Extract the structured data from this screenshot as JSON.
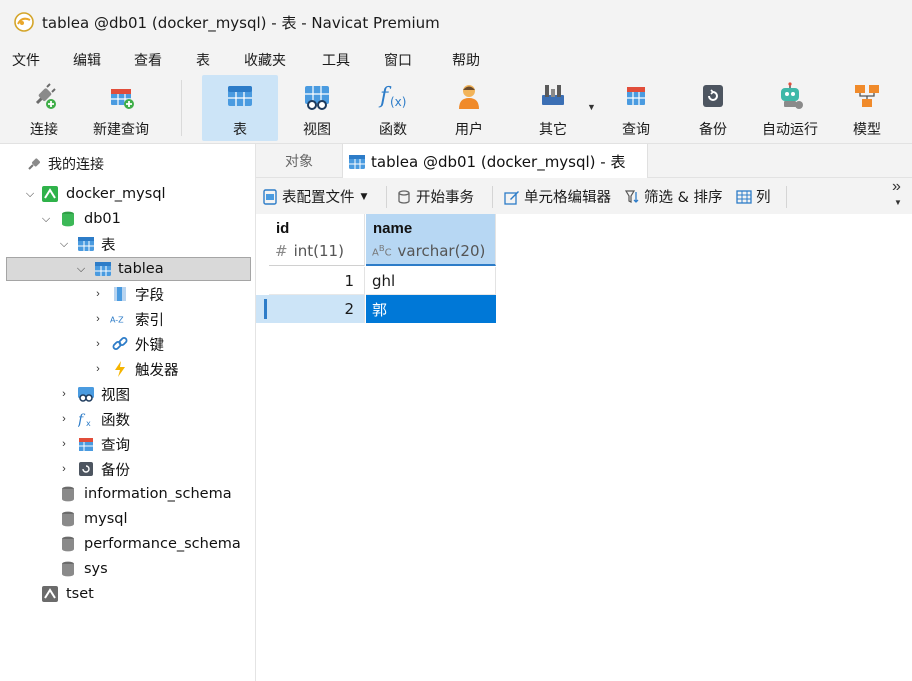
{
  "window": {
    "title": "tablea @db01 (docker_mysql) - 表 - Navicat Premium"
  },
  "menu": [
    "文件",
    "编辑",
    "查看",
    "表",
    "收藏夹",
    "工具",
    "窗口",
    "帮助"
  ],
  "toolbar": {
    "connect": "连接",
    "new_query": "新建查询",
    "table": "表",
    "view": "视图",
    "function": "函数",
    "user": "用户",
    "other": "其它",
    "query": "查询",
    "backup": "备份",
    "auto_run": "自动运行",
    "model": "模型"
  },
  "nav": {
    "header": "我的连接",
    "connection": "docker_mysql",
    "database": "db01",
    "tables_group": "表",
    "table": "tablea",
    "fields": "字段",
    "indexes": "索引",
    "foreign_keys": "外键",
    "triggers": "触发器",
    "views": "视图",
    "functions": "函数",
    "queries": "查询",
    "backups": "备份",
    "other_dbs": [
      "information_schema",
      "mysql",
      "performance_schema",
      "sys"
    ],
    "second_connection": "tset"
  },
  "tabs": {
    "objects": "对象",
    "active": "tablea @db01 (docker_mysql) - 表"
  },
  "subtoolbar": {
    "table_profile": "表配置文件",
    "begin_transaction": "开始事务",
    "cell_editor": "单元格编辑器",
    "filter_sort": "筛选 & 排序",
    "columns": "列",
    "more": "»"
  },
  "grid": {
    "columns": [
      {
        "name": "id",
        "type": "int(11)"
      },
      {
        "name": "name",
        "type": "varchar(20)"
      }
    ],
    "rows": [
      {
        "id": "1",
        "name": "ghl"
      },
      {
        "id": "2",
        "name": "郭"
      }
    ]
  },
  "colors": {
    "accent": "#0078d7",
    "selected_cell": "#0078d7",
    "selected_row": "#cce4f7",
    "header_highlight": "#b7d7f3",
    "toolbar_active": "#cce4f7"
  }
}
